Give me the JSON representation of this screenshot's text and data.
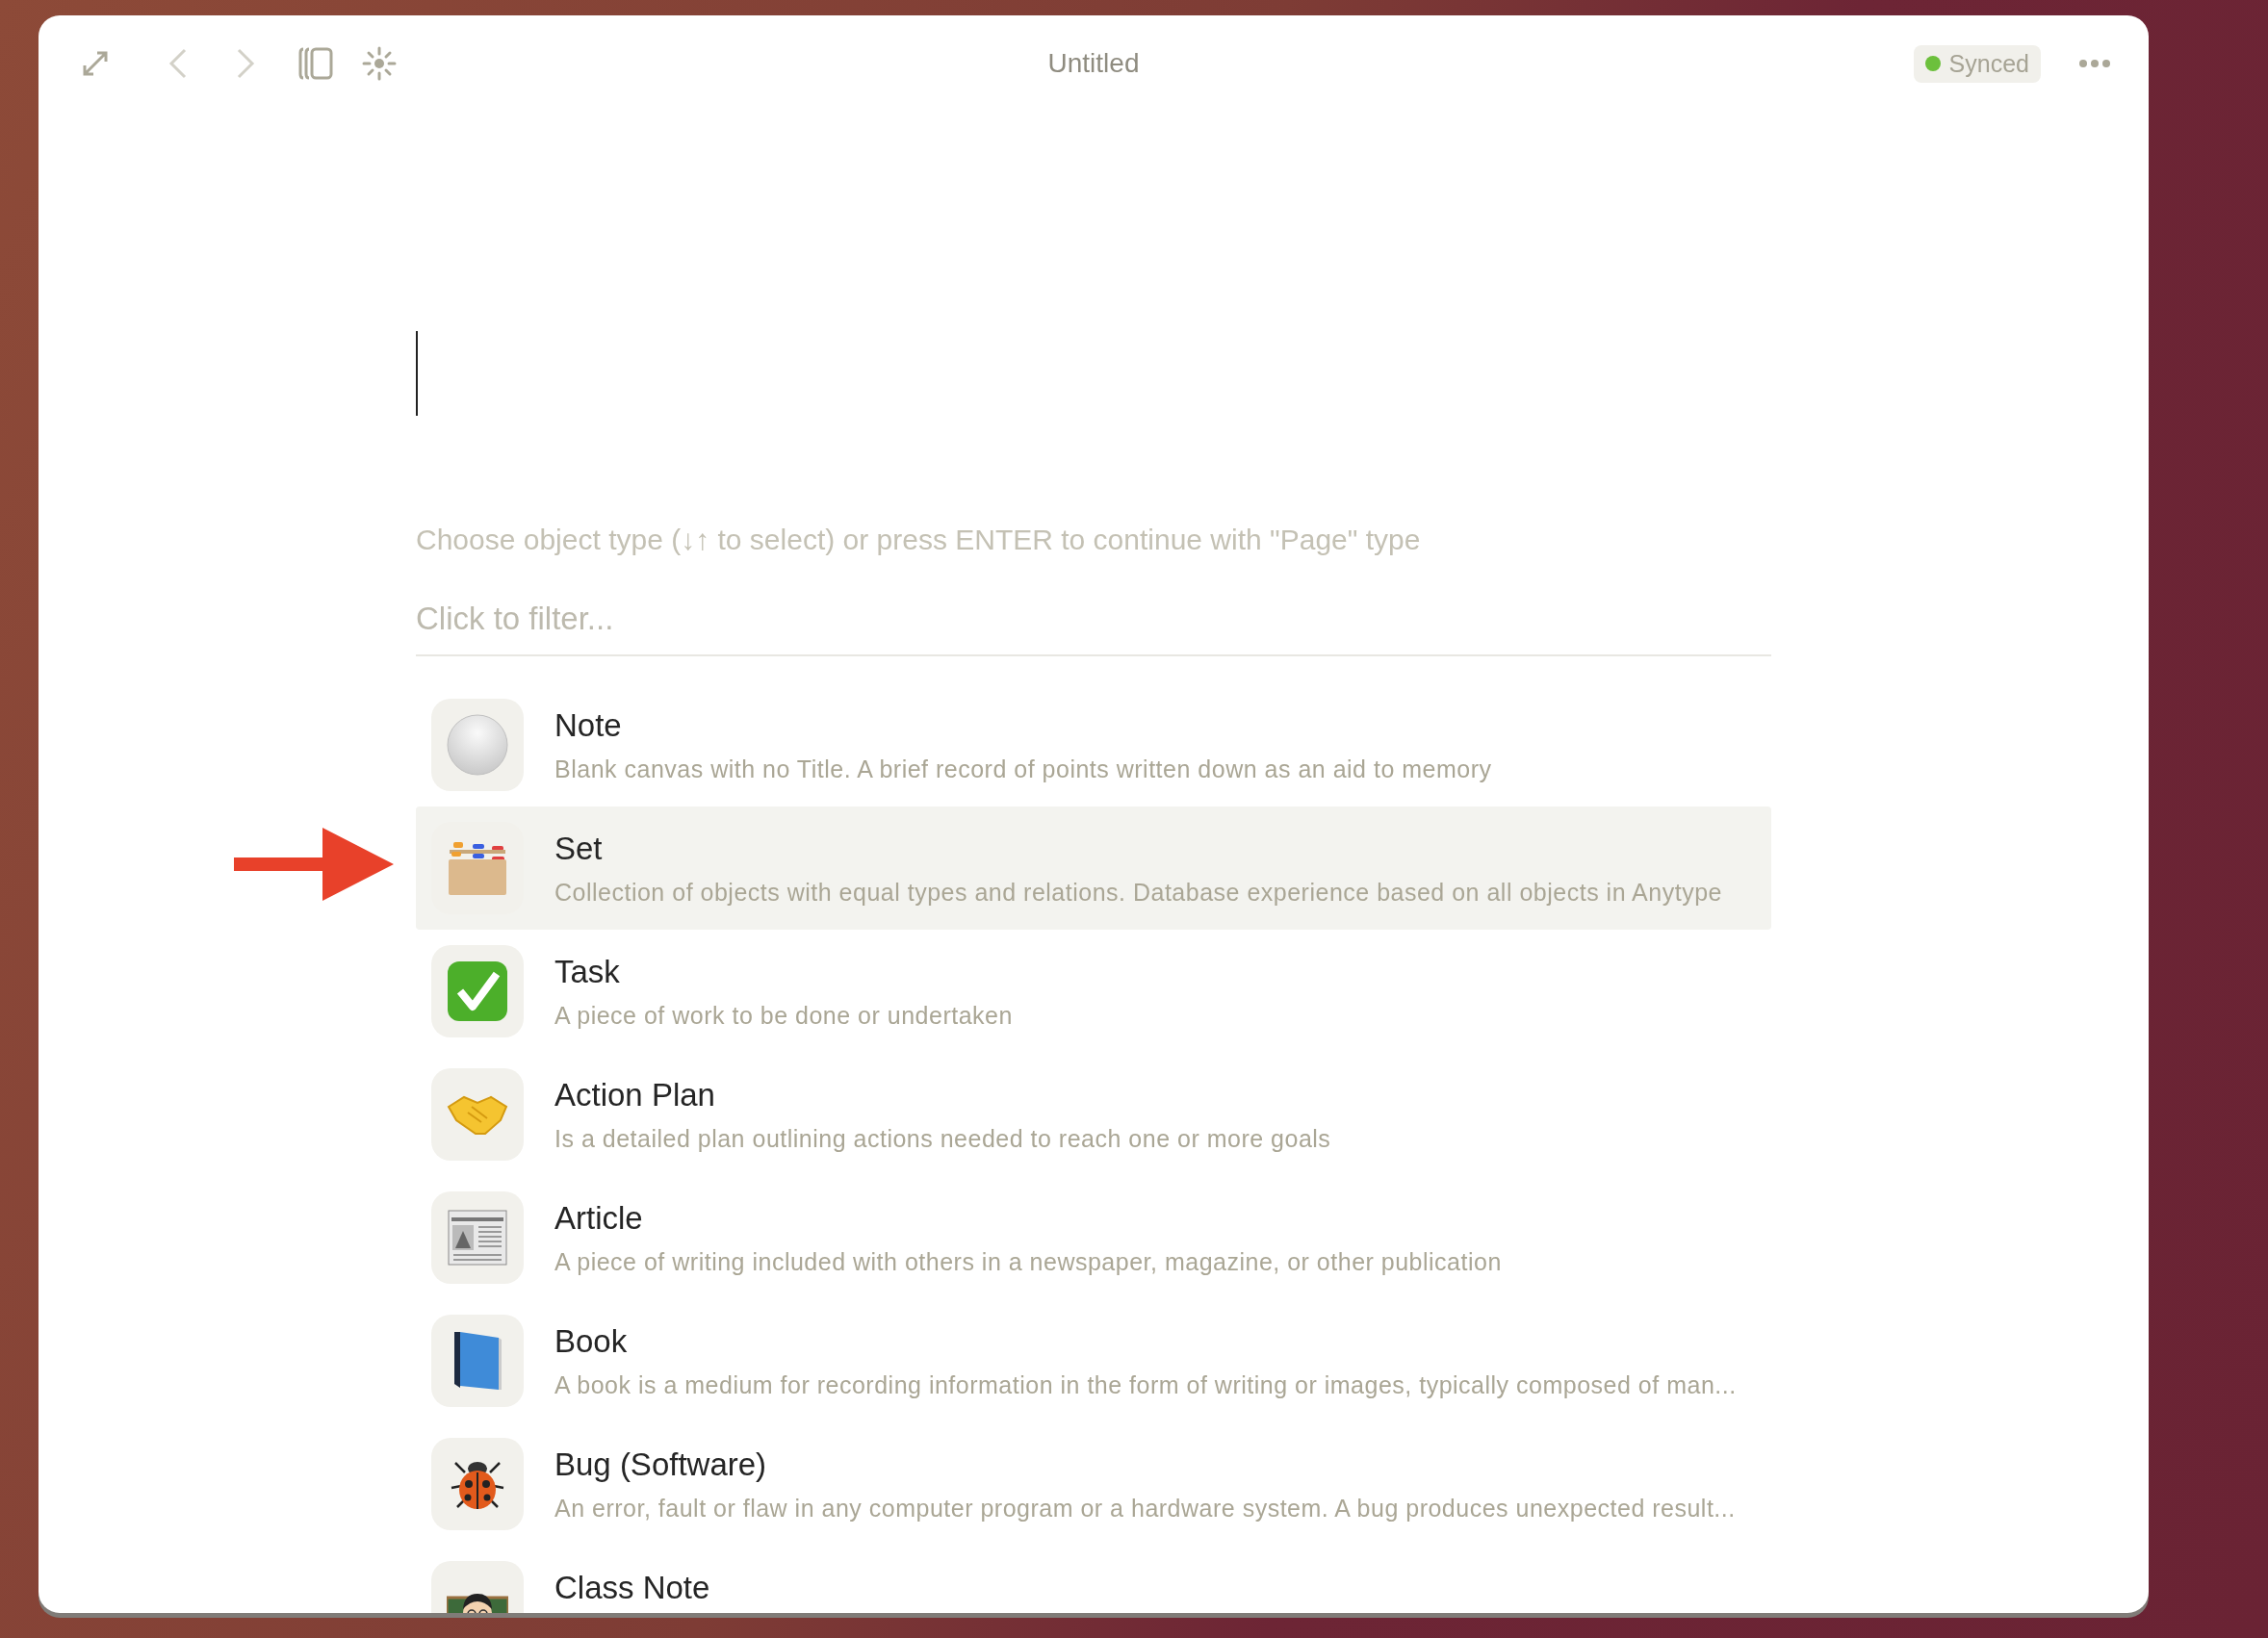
{
  "window": {
    "title": "Untitled",
    "sync_status": "Synced"
  },
  "editor": {
    "hint": "Choose object type (↓↑ to select) or press ENTER to continue with \"Page\" type",
    "filter": {
      "placeholder": "Click to filter..."
    }
  },
  "object_types": [
    {
      "kind": "note",
      "name": "Note",
      "description": "Blank canvas with no Title. A brief record of points written down as an aid to memory",
      "selected": false
    },
    {
      "kind": "set",
      "name": "Set",
      "description": "Collection of objects with equal types and relations. Database experience based on all objects in Anytype",
      "selected": true
    },
    {
      "kind": "task",
      "name": "Task",
      "description": "A piece of work to be done or undertaken",
      "selected": false
    },
    {
      "kind": "action_plan",
      "name": "Action Plan",
      "description": "Is a detailed plan outlining actions needed to reach one or more goals",
      "selected": false
    },
    {
      "kind": "article",
      "name": "Article",
      "description": "A piece of writing included with others in a newspaper, magazine, or other publication",
      "selected": false
    },
    {
      "kind": "book",
      "name": "Book",
      "description": "A book is a medium for recording information in the form of writing or images, typically composed of man...",
      "selected": false
    },
    {
      "kind": "bug",
      "name": "Bug (Software)",
      "description": "An error, fault or flaw in any computer program or a hardware system. A bug produces unexpected result...",
      "selected": false
    },
    {
      "kind": "class_note",
      "name": "Class Note",
      "selected": false
    }
  ]
}
